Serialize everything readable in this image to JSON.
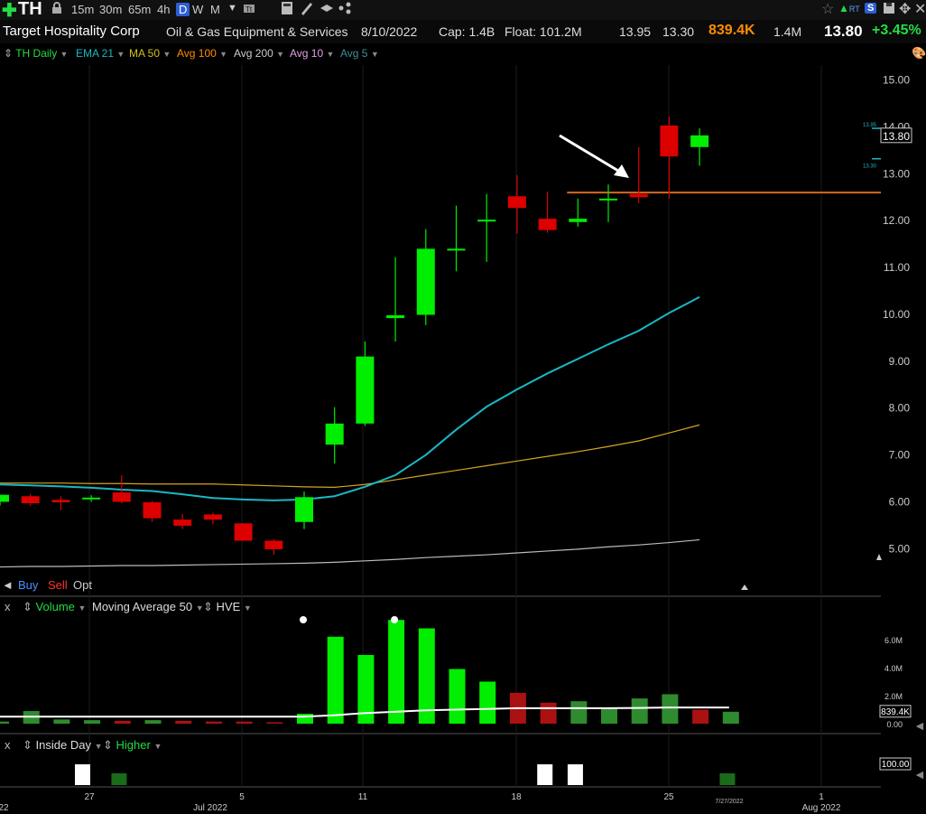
{
  "toolbar": {
    "symbol": "TH",
    "timeframes": [
      "15m",
      "30m",
      "65m",
      "4h",
      "D",
      "W",
      "M"
    ],
    "active_timeframe": "D",
    "rt_label": "RT",
    "s_label": "S"
  },
  "info": {
    "company": "Target Hospitality Corp",
    "industry": "Oil & Gas Equipment & Services",
    "date": "8/10/2022",
    "cap": "Cap: 1.4B",
    "float": "Float: 101.2M",
    "high": "13.95",
    "low": "13.30",
    "volume": "839.4K",
    "avg_volume": "1.4M",
    "last": "13.80",
    "change": "+3.45%"
  },
  "studies": {
    "th_daily": "TH Daily",
    "ema21": "EMA 21",
    "ma50": "MA 50",
    "avg100": "Avg 100",
    "avg200": "Avg 200",
    "avg10": "Avg 10",
    "avg5": "Avg 5"
  },
  "trade": {
    "buy": "Buy",
    "sell": "Sell",
    "opt": "Opt"
  },
  "volume_panel": {
    "close": "x",
    "volume": "Volume",
    "ma50": "Moving Average 50",
    "hve": "HVE",
    "current_label": "839.4K"
  },
  "inside_panel": {
    "close": "x",
    "inside_day": "Inside Day",
    "higher": "Higher",
    "level_label": "100.00"
  },
  "colors": {
    "up": "#00ee00",
    "down": "#dd0000",
    "ema21": "#19b8c4",
    "ma50": "#d4a520",
    "avg200": "#bbbbbb",
    "resistance": "#d46a1f",
    "accent_green": "#22dd44",
    "accent_orange": "#ff8c00"
  },
  "chart_data": [
    {
      "type": "candlestick",
      "title": "TH Daily",
      "x": [
        "6/23",
        "6/24",
        "6/27",
        "6/28",
        "6/29",
        "6/30",
        "7/1",
        "7/5",
        "7/6",
        "7/7",
        "7/8",
        "7/11",
        "7/12",
        "7/13",
        "7/14",
        "7/15",
        "7/18",
        "7/19",
        "7/20",
        "7/21",
        "7/22",
        "7/25",
        "7/26",
        "7/27"
      ],
      "open": [
        5.98,
        6.1,
        6.02,
        6.05,
        6.18,
        5.97,
        5.6,
        5.71,
        5.52,
        5.15,
        5.55,
        7.2,
        7.65,
        9.9,
        9.97,
        11.35,
        12.0,
        12.5,
        12.02,
        11.95,
        12.42,
        12.55,
        14.01,
        13.55
      ],
      "high": [
        6.1,
        6.15,
        6.1,
        6.12,
        6.55,
        6.0,
        5.72,
        5.75,
        5.52,
        5.18,
        6.2,
        8.0,
        9.4,
        11.2,
        11.8,
        12.3,
        12.55,
        12.95,
        12.6,
        12.45,
        12.75,
        13.55,
        14.2,
        13.95
      ],
      "low": [
        5.9,
        5.9,
        5.8,
        5.98,
        5.95,
        5.55,
        5.4,
        5.5,
        5.15,
        4.85,
        5.4,
        6.8,
        7.6,
        9.4,
        9.75,
        10.9,
        11.1,
        11.7,
        11.72,
        11.85,
        11.95,
        12.35,
        12.45,
        13.15
      ],
      "close": [
        6.13,
        5.95,
        5.97,
        6.07,
        5.98,
        5.63,
        5.47,
        5.6,
        5.15,
        4.97,
        6.08,
        7.65,
        9.08,
        9.96,
        11.38,
        11.38,
        12.0,
        12.25,
        11.78,
        12.02,
        12.45,
        12.48,
        13.35,
        13.8
      ],
      "ema21": [
        6.35,
        6.33,
        6.31,
        6.28,
        6.24,
        6.21,
        6.14,
        6.06,
        6.03,
        6.01,
        6.03,
        6.1,
        6.3,
        6.55,
        6.98,
        7.52,
        8.01,
        8.38,
        8.72,
        9.03,
        9.34,
        9.63,
        10.01,
        10.35
      ],
      "ma50": [
        6.38,
        6.38,
        6.38,
        6.37,
        6.37,
        6.36,
        6.36,
        6.36,
        6.34,
        6.32,
        6.3,
        6.29,
        6.35,
        6.45,
        6.55,
        6.65,
        6.75,
        6.85,
        6.95,
        7.05,
        7.16,
        7.28,
        7.45,
        7.62
      ],
      "avg200": [
        4.59,
        4.6,
        4.6,
        4.61,
        4.62,
        4.62,
        4.63,
        4.64,
        4.65,
        4.66,
        4.67,
        4.69,
        4.72,
        4.75,
        4.79,
        4.82,
        4.85,
        4.89,
        4.93,
        4.97,
        5.02,
        5.06,
        5.11,
        5.17
      ],
      "resistance": 12.58,
      "y_ticks": [
        5.0,
        6.0,
        7.0,
        8.0,
        9.0,
        10.0,
        11.0,
        12.0,
        13.0,
        14.0,
        15.0
      ],
      "y_tick_labels": [
        "5.00",
        "6.00",
        "7.00",
        "8.00",
        "9.00",
        "10.00",
        "11.00",
        "12.00",
        "13.00",
        "14.00",
        "15.00"
      ],
      "ylim": [
        4.35,
        15.3
      ],
      "last_price_label": "13.80",
      "high_tag": "13.95",
      "low_tag": "13.30",
      "x_tick_labels": [
        "22",
        "27",
        "Jul 2022",
        "5",
        "11",
        "18",
        "25",
        "1",
        "Aug 2022"
      ],
      "hover_date": "7/27/2022"
    },
    {
      "type": "bar",
      "title": "Volume",
      "values": [
        0.15,
        0.9,
        0.3,
        0.25,
        0.2,
        0.25,
        0.2,
        0.15,
        0.15,
        0.1,
        0.7,
        6.2,
        4.9,
        7.4,
        6.8,
        3.9,
        3.0,
        2.2,
        1.5,
        1.6,
        1.1,
        1.8,
        2.1,
        1.0,
        0.85
      ],
      "up": [
        true,
        true,
        true,
        true,
        false,
        true,
        false,
        false,
        false,
        false,
        true,
        true,
        true,
        true,
        true,
        true,
        true,
        false,
        false,
        true,
        true,
        true,
        true,
        false,
        true
      ],
      "ma50": [
        0.5,
        0.5,
        0.5,
        0.5,
        0.5,
        0.5,
        0.5,
        0.5,
        0.5,
        0.5,
        0.5,
        0.6,
        0.75,
        0.85,
        0.95,
        1.0,
        1.05,
        1.1,
        1.1,
        1.1,
        1.1,
        1.12,
        1.15,
        1.15,
        1.15
      ],
      "hve_markers": [
        10,
        13
      ],
      "y_tick_labels": [
        "0.00",
        "2.0M",
        "4.0M",
        "6.0M"
      ],
      "y_ticks": [
        0,
        2,
        4,
        6
      ],
      "ylim": [
        0,
        7.8
      ]
    },
    {
      "type": "bar",
      "title": "Inside Day",
      "values": [
        1,
        1,
        1,
        1,
        1
      ],
      "kinds": [
        "inside",
        "higher",
        "inside",
        "inside",
        "higher"
      ],
      "y_tick_labels": [
        "100.00"
      ]
    }
  ]
}
